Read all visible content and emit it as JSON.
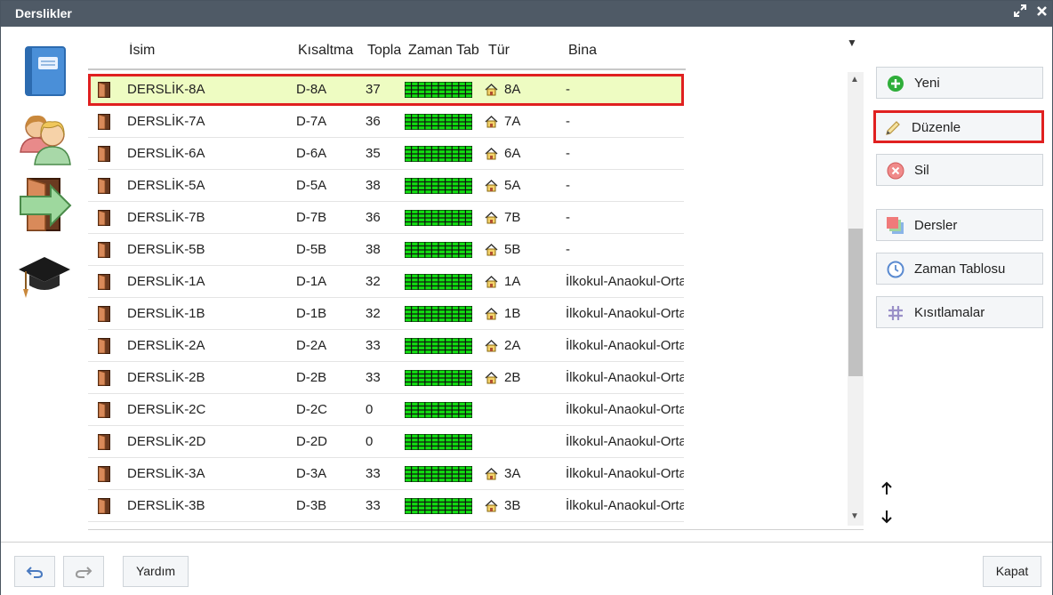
{
  "window": {
    "title": "Derslikler",
    "maximize_icon": "expand-icon",
    "close_icon": "close-icon"
  },
  "left_nav": [
    {
      "name": "book-icon"
    },
    {
      "name": "teachers-icon"
    },
    {
      "name": "classroom-door-icon"
    },
    {
      "name": "graduation-cap-icon"
    }
  ],
  "columns": {
    "name": "İsim",
    "short": "Kısaltma",
    "total": "Topla",
    "timetable": "Zaman Tab",
    "type": "Tür",
    "building": "Bina"
  },
  "rows": [
    {
      "name": "DERSLİK-8A",
      "short": "D-8A",
      "total": "37",
      "type": "8A",
      "building": "-",
      "has_type": true
    },
    {
      "name": "DERSLİK-7A",
      "short": "D-7A",
      "total": "36",
      "type": "7A",
      "building": "-",
      "has_type": true
    },
    {
      "name": "DERSLİK-6A",
      "short": "D-6A",
      "total": "35",
      "type": "6A",
      "building": "-",
      "has_type": true
    },
    {
      "name": "DERSLİK-5A",
      "short": "D-5A",
      "total": "38",
      "type": "5A",
      "building": "-",
      "has_type": true
    },
    {
      "name": "DERSLİK-7B",
      "short": "D-7B",
      "total": "36",
      "type": "7B",
      "building": "-",
      "has_type": true
    },
    {
      "name": "DERSLİK-5B",
      "short": "D-5B",
      "total": "38",
      "type": "5B",
      "building": "-",
      "has_type": true
    },
    {
      "name": "DERSLİK-1A",
      "short": "D-1A",
      "total": "32",
      "type": "1A",
      "building": "İlkokul-Anaokul-Orta",
      "has_type": true
    },
    {
      "name": "DERSLİK-1B",
      "short": "D-1B",
      "total": "32",
      "type": "1B",
      "building": "İlkokul-Anaokul-Orta",
      "has_type": true
    },
    {
      "name": "DERSLİK-2A",
      "short": "D-2A",
      "total": "33",
      "type": "2A",
      "building": "İlkokul-Anaokul-Orta",
      "has_type": true
    },
    {
      "name": "DERSLİK-2B",
      "short": "D-2B",
      "total": "33",
      "type": "2B",
      "building": "İlkokul-Anaokul-Orta",
      "has_type": true
    },
    {
      "name": "DERSLİK-2C",
      "short": "D-2C",
      "total": "0",
      "type": "",
      "building": "İlkokul-Anaokul-Orta",
      "has_type": false
    },
    {
      "name": "DERSLİK-2D",
      "short": "D-2D",
      "total": "0",
      "type": "",
      "building": "İlkokul-Anaokul-Orta",
      "has_type": false
    },
    {
      "name": "DERSLİK-3A",
      "short": "D-3A",
      "total": "33",
      "type": "3A",
      "building": "İlkokul-Anaokul-Orta",
      "has_type": true
    },
    {
      "name": "DERSLİK-3B",
      "short": "D-3B",
      "total": "33",
      "type": "3B",
      "building": "İlkokul-Anaokul-Orta",
      "has_type": true
    }
  ],
  "selected_row": 0,
  "side_buttons": {
    "new": "Yeni",
    "edit": "Düzenle",
    "delete": "Sil",
    "lessons": "Dersler",
    "timetable": "Zaman Tablosu",
    "constraints": "Kısıtlamalar"
  },
  "footer": {
    "help": "Yardım",
    "close": "Kapat"
  },
  "colors": {
    "titlebar": "#4f5a66",
    "selected_bg": "#eefcc2",
    "highlight_border": "#e02020",
    "timetable_green": "#11dd11"
  }
}
